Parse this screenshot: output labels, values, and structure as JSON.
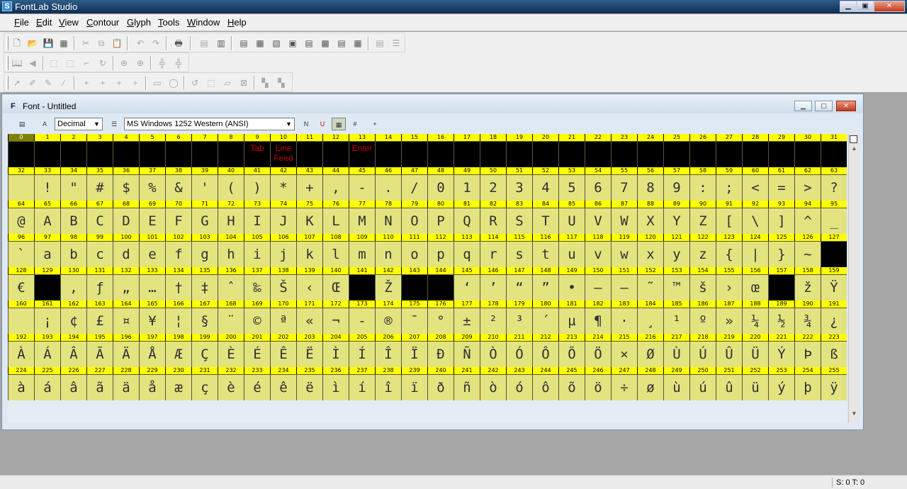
{
  "app": {
    "title": "FontLab Studio"
  },
  "menu": [
    "File",
    "Edit",
    "View",
    "Contour",
    "Glyph",
    "Tools",
    "Window",
    "Help"
  ],
  "font_window": {
    "title": "Font - Untitled",
    "numbering_mode": "Decimal",
    "encoding": "MS Windows 1252 Western (ANSI)"
  },
  "status": {
    "text": "S: 0 T: 0"
  },
  "glyph_grid": {
    "columns": 32,
    "rows": [
      {
        "labels": [
          "0",
          "1",
          "2",
          "3",
          "4",
          "5",
          "6",
          "7",
          "8",
          "9",
          "10",
          "11",
          "12",
          "13",
          "14",
          "15",
          "16",
          "17",
          "18",
          "19",
          "20",
          "21",
          "22",
          "23",
          "24",
          "25",
          "26",
          "27",
          "28",
          "29",
          "30",
          "31"
        ],
        "cells": [
          "",
          "",
          "",
          "",
          "",
          "",
          "",
          "",
          "",
          "",
          "",
          "",
          "",
          "",
          "",
          "",
          "",
          "",
          "",
          "",
          "",
          "",
          "",
          "",
          "",
          "",
          "",
          "",
          "",
          "",
          "",
          ""
        ]
      },
      {
        "labels": [
          "32",
          "33",
          "34",
          "35",
          "36",
          "37",
          "38",
          "39",
          "40",
          "41",
          "42",
          "43",
          "44",
          "45",
          "46",
          "47",
          "48",
          "49",
          "50",
          "51",
          "52",
          "53",
          "54",
          "55",
          "56",
          "57",
          "58",
          "59",
          "60",
          "61",
          "62",
          "63"
        ],
        "cells": [
          "",
          "!",
          "\"",
          "#",
          "$",
          "%",
          "&",
          "'",
          "(",
          ")",
          "*",
          "+",
          ",",
          "-",
          ".",
          "/",
          "0",
          "1",
          "2",
          "3",
          "4",
          "5",
          "6",
          "7",
          "8",
          "9",
          ":",
          ";",
          "<",
          "=",
          ">",
          "?"
        ]
      },
      {
        "labels": [
          "64",
          "65",
          "66",
          "67",
          "68",
          "69",
          "70",
          "71",
          "72",
          "73",
          "74",
          "75",
          "76",
          "77",
          "78",
          "79",
          "80",
          "81",
          "82",
          "83",
          "84",
          "85",
          "86",
          "87",
          "88",
          "89",
          "90",
          "91",
          "92",
          "93",
          "94",
          "95"
        ],
        "cells": [
          "@",
          "A",
          "B",
          "C",
          "D",
          "E",
          "F",
          "G",
          "H",
          "I",
          "J",
          "K",
          "L",
          "M",
          "N",
          "O",
          "P",
          "Q",
          "R",
          "S",
          "T",
          "U",
          "V",
          "W",
          "X",
          "Y",
          "Z",
          "[",
          "\\",
          "]",
          "^",
          "_"
        ]
      },
      {
        "labels": [
          "96",
          "97",
          "98",
          "99",
          "100",
          "101",
          "102",
          "103",
          "104",
          "105",
          "106",
          "107",
          "108",
          "109",
          "110",
          "111",
          "112",
          "113",
          "114",
          "115",
          "116",
          "117",
          "118",
          "119",
          "120",
          "121",
          "122",
          "123",
          "124",
          "125",
          "126",
          "127"
        ],
        "cells": [
          "`",
          "a",
          "b",
          "c",
          "d",
          "e",
          "f",
          "g",
          "h",
          "i",
          "j",
          "k",
          "l",
          "m",
          "n",
          "o",
          "p",
          "q",
          "r",
          "s",
          "t",
          "u",
          "v",
          "w",
          "x",
          "y",
          "z",
          "{",
          "|",
          "}",
          "~",
          ""
        ]
      },
      {
        "labels": [
          "128",
          "129",
          "130",
          "131",
          "132",
          "133",
          "134",
          "135",
          "136",
          "137",
          "138",
          "139",
          "140",
          "141",
          "142",
          "143",
          "144",
          "145",
          "146",
          "147",
          "148",
          "149",
          "150",
          "151",
          "152",
          "153",
          "154",
          "155",
          "156",
          "157",
          "158",
          "159"
        ],
        "cells": [
          "€",
          "",
          "‚",
          "ƒ",
          "„",
          "…",
          "†",
          "‡",
          "ˆ",
          "‰",
          "Š",
          "‹",
          "Œ",
          "",
          "Ž",
          "",
          "",
          "‘",
          "’",
          "“",
          "”",
          "•",
          "–",
          "—",
          "˜",
          "™",
          "š",
          "›",
          "œ",
          "",
          "ž",
          "Ÿ"
        ]
      },
      {
        "labels": [
          "160",
          "161",
          "162",
          "163",
          "164",
          "165",
          "166",
          "167",
          "168",
          "169",
          "170",
          "171",
          "172",
          "173",
          "174",
          "175",
          "176",
          "177",
          "178",
          "179",
          "180",
          "181",
          "182",
          "183",
          "184",
          "185",
          "186",
          "187",
          "188",
          "189",
          "190",
          "191"
        ],
        "cells": [
          "",
          "¡",
          "¢",
          "£",
          "¤",
          "¥",
          "¦",
          "§",
          "¨",
          "©",
          "ª",
          "«",
          "¬",
          "-",
          "®",
          "¯",
          "°",
          "±",
          "²",
          "³",
          "´",
          "µ",
          "¶",
          "·",
          "¸",
          "¹",
          "º",
          "»",
          "¼",
          "½",
          "¾",
          "¿"
        ]
      },
      {
        "labels": [
          "192",
          "193",
          "194",
          "195",
          "196",
          "197",
          "198",
          "199",
          "200",
          "201",
          "202",
          "203",
          "204",
          "205",
          "206",
          "207",
          "208",
          "209",
          "210",
          "211",
          "212",
          "213",
          "214",
          "215",
          "216",
          "217",
          "218",
          "219",
          "220",
          "221",
          "222",
          "223"
        ],
        "cells": [
          "À",
          "Á",
          "Â",
          "Ã",
          "Ä",
          "Å",
          "Æ",
          "Ç",
          "È",
          "É",
          "Ê",
          "Ë",
          "Ì",
          "Í",
          "Î",
          "Ï",
          "Ð",
          "Ñ",
          "Ò",
          "Ó",
          "Ô",
          "Õ",
          "Ö",
          "×",
          "Ø",
          "Ù",
          "Ú",
          "Û",
          "Ü",
          "Ý",
          "Þ",
          "ß"
        ]
      },
      {
        "labels": [
          "224",
          "225",
          "226",
          "227",
          "228",
          "229",
          "230",
          "231",
          "232",
          "233",
          "234",
          "235",
          "236",
          "237",
          "238",
          "239",
          "240",
          "241",
          "242",
          "243",
          "244",
          "245",
          "246",
          "247",
          "248",
          "249",
          "250",
          "251",
          "252",
          "253",
          "254",
          "255"
        ],
        "cells": [
          "à",
          "á",
          "â",
          "ã",
          "ä",
          "å",
          "æ",
          "ç",
          "è",
          "é",
          "ê",
          "ë",
          "ì",
          "í",
          "î",
          "ï",
          "ð",
          "ñ",
          "ò",
          "ó",
          "ô",
          "õ",
          "ö",
          "÷",
          "ø",
          "ù",
          "ú",
          "û",
          "ü",
          "ý",
          "þ",
          "ÿ"
        ]
      }
    ],
    "control_labels": {
      "9": "Tab",
      "10": "Line Feed",
      "13": "Enter"
    },
    "empty_black": [
      127,
      129,
      141,
      143,
      144,
      157
    ]
  }
}
